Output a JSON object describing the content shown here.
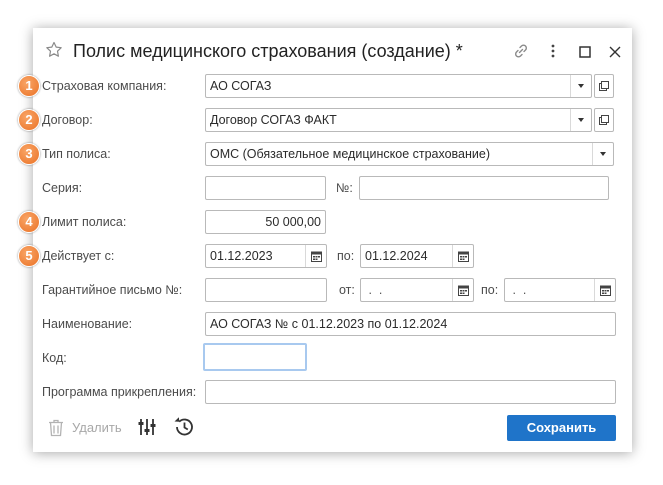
{
  "window": {
    "title": "Полис медицинского страхования (создание) *",
    "icons": {
      "favorite": "star-icon",
      "link": "link-icon",
      "more": "more-icon",
      "maximize": "maximize-icon",
      "close": "close-icon"
    }
  },
  "badges": [
    "1",
    "2",
    "3",
    "4",
    "5"
  ],
  "form": {
    "insurer": {
      "label": "Страховая компания:",
      "value": "АО СОГАЗ"
    },
    "contract": {
      "label": "Договор:",
      "value": "Договор СОГАЗ ФАКТ"
    },
    "policy_type": {
      "label": "Тип полиса:",
      "value": "ОМС (Обязательное медицинское страхование)"
    },
    "series": {
      "label": "Серия:",
      "value": "",
      "number_label": "№:",
      "number_value": ""
    },
    "limit": {
      "label": "Лимит полиса:",
      "value": "50 000,00"
    },
    "valid": {
      "label": "Действует с:",
      "from": "01.12.2023",
      "to_label": "по:",
      "to": "01.12.2024"
    },
    "guarantee": {
      "label": "Гарантийное письмо №:",
      "value": "",
      "from_label": "от:",
      "from": " .  .",
      "to_label": "по:",
      "to": " .  ."
    },
    "name": {
      "label": "Наименование:",
      "value": "АО СОГАЗ № с 01.12.2023 по 01.12.2024"
    },
    "code": {
      "label": "Код:",
      "value": ""
    },
    "program": {
      "label": "Программа прикрепления:",
      "value": ""
    }
  },
  "footer": {
    "delete_label": "Удалить",
    "save_label": "Сохранить",
    "icons": {
      "delete": "trash-icon",
      "settings": "settings-sliders-icon",
      "history": "history-icon"
    }
  },
  "colors": {
    "accent": "#1f74c9",
    "badge": "#ea7226",
    "focus_border": "#a8c9ef",
    "disabled_text": "#a8a8a8"
  }
}
